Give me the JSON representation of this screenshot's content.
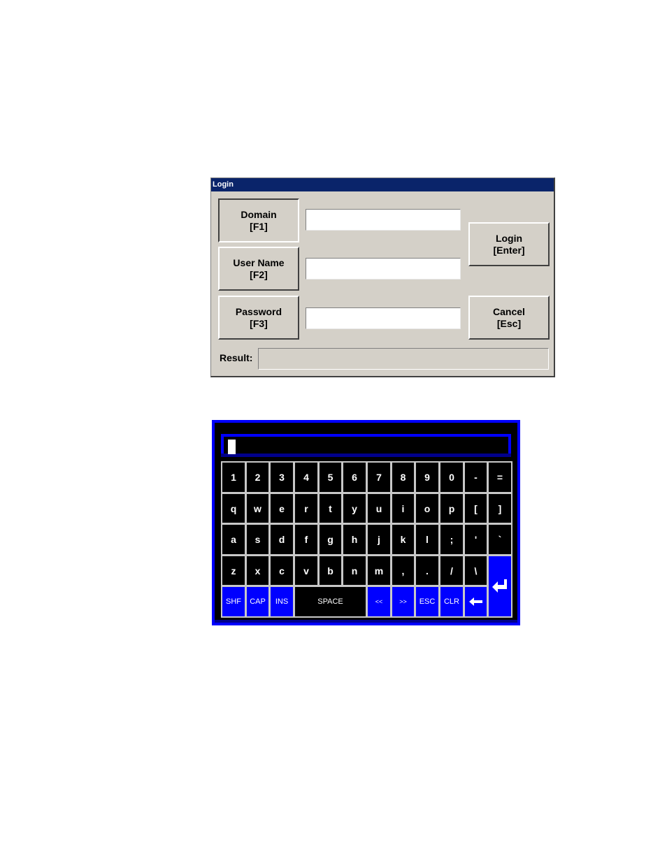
{
  "login_dialog": {
    "title": "Login",
    "domain_button": {
      "line1": "Domain",
      "line2": "[F1]"
    },
    "username_button": {
      "line1": "User Name",
      "line2": "[F2]"
    },
    "password_button": {
      "line1": "Password",
      "line2": "[F3]"
    },
    "login_button": {
      "line1": "Login",
      "line2": "[Enter]"
    },
    "cancel_button": {
      "line1": "Cancel",
      "line2": "[Esc]"
    },
    "domain_value": "",
    "username_value": "",
    "password_value": "",
    "result_label": "Result:",
    "result_value": ""
  },
  "keyboard": {
    "input_value": "",
    "rows": [
      [
        "1",
        "2",
        "3",
        "4",
        "5",
        "6",
        "7",
        "8",
        "9",
        "0",
        "-",
        "="
      ],
      [
        "q",
        "w",
        "e",
        "r",
        "t",
        "y",
        "u",
        "i",
        "o",
        "p",
        "[",
        "]"
      ],
      [
        "a",
        "s",
        "d",
        "f",
        "g",
        "h",
        "j",
        "k",
        "l",
        ";",
        "'",
        "`"
      ],
      [
        "z",
        "x",
        "c",
        "v",
        "b",
        "n",
        "m",
        ",",
        ".",
        "/",
        "\\"
      ]
    ],
    "function_keys": {
      "shift": "SHF",
      "caps": "CAP",
      "insert": "INS",
      "space": "SPACE",
      "left": "<<",
      "right": ">>",
      "escape": "ESC",
      "clear": "CLR",
      "backspace_icon": "left-arrow-icon",
      "enter_icon": "enter-return-icon"
    },
    "colors": {
      "frame": "#0000ff",
      "key_background": "#000000",
      "function_key_background": "#0000ff",
      "key_border": "#c8c8c8"
    }
  }
}
